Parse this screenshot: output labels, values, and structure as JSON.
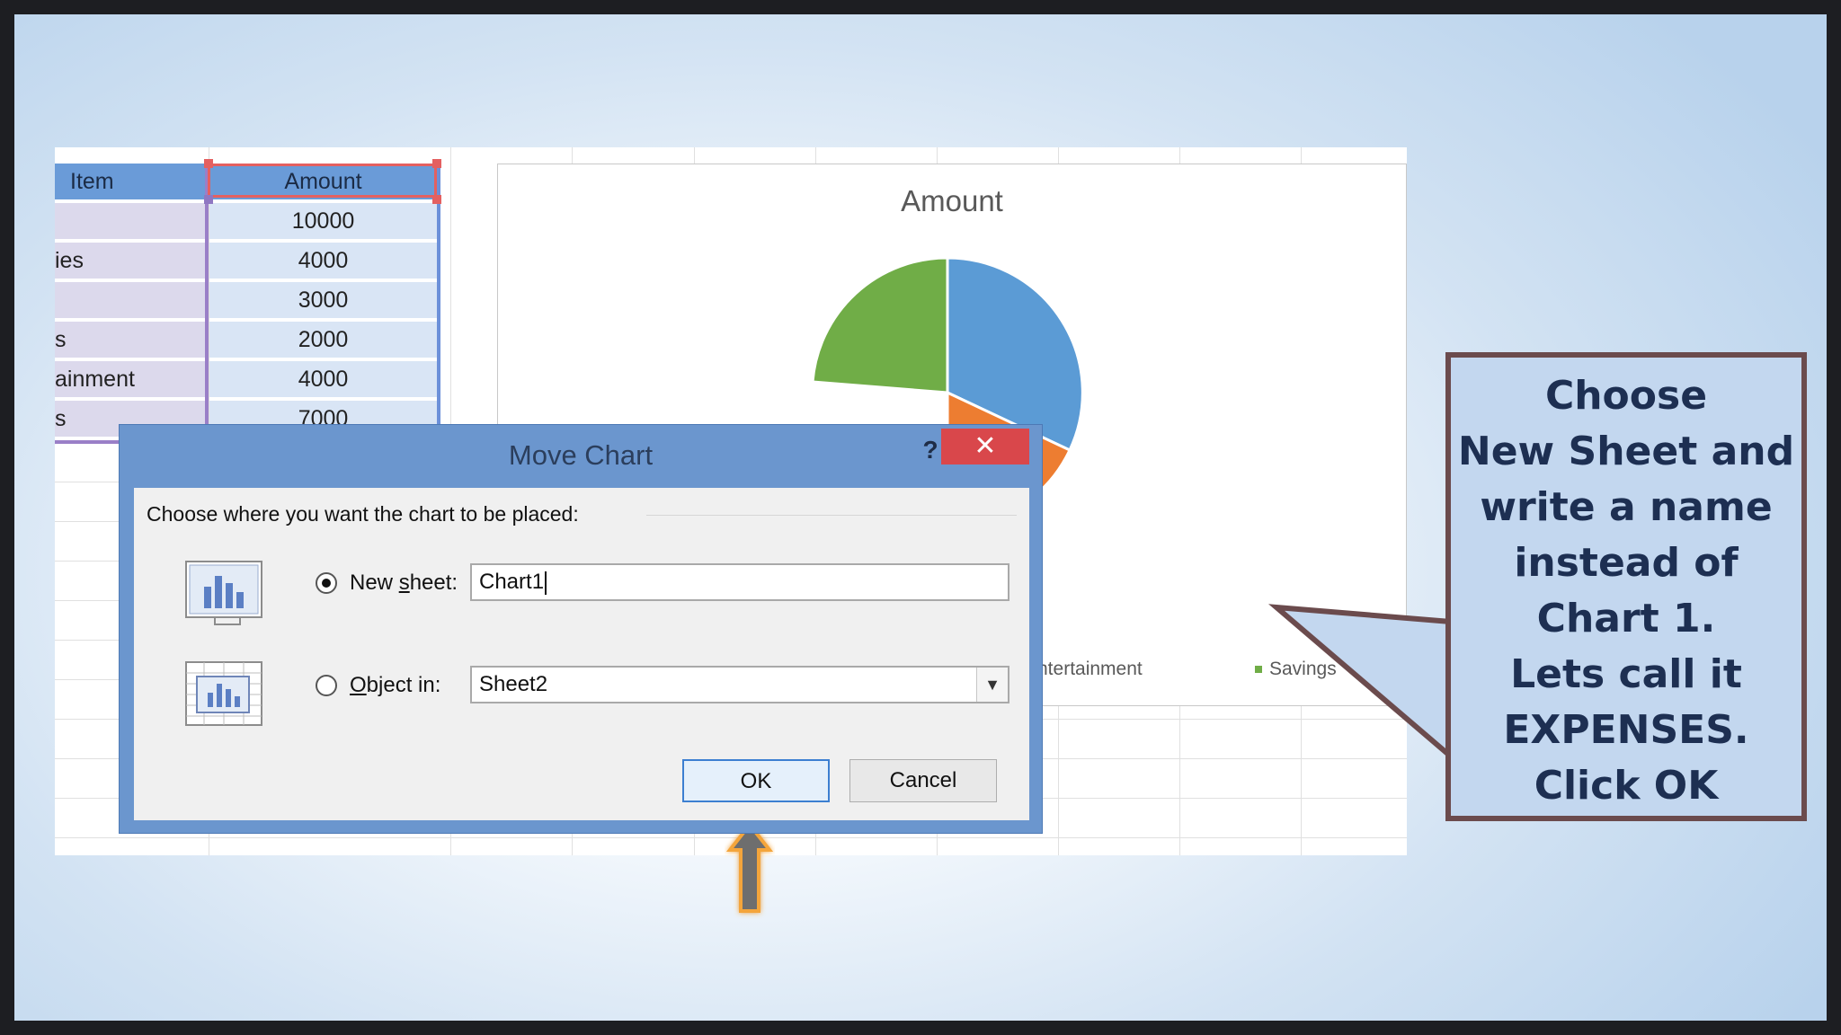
{
  "table": {
    "header": {
      "item": "Item",
      "amount": "Amount"
    },
    "rows": [
      {
        "item": "",
        "amount": "10000"
      },
      {
        "item": "ies",
        "amount": "4000"
      },
      {
        "item": "",
        "amount": "3000"
      },
      {
        "item": "s",
        "amount": "2000"
      },
      {
        "item": "ainment",
        "amount": "4000"
      },
      {
        "item": "s",
        "amount": "7000"
      }
    ]
  },
  "chart": {
    "title": "Amount",
    "legend": [
      {
        "label": "Entertainment",
        "color": "#ed7d31"
      },
      {
        "label": "Savings",
        "color": "#70ad47"
      }
    ],
    "colors": {
      "blue": "#5b9bd5",
      "orange": "#ed7d31",
      "green": "#70ad47"
    }
  },
  "dialog": {
    "title": "Move Chart",
    "help_label": "?",
    "close_label": "✕",
    "prompt": "Choose where you want the chart to be placed:",
    "new_sheet": {
      "label_pre": "New ",
      "label_u": "s",
      "label_post": "heet:",
      "value": "Chart1",
      "selected": true
    },
    "object_in": {
      "label_pre": "",
      "label_u": "O",
      "label_post": "bject in:",
      "value": "Sheet2",
      "selected": false
    },
    "ok_label": "OK",
    "cancel_label": "Cancel"
  },
  "callout": {
    "lines": [
      "Choose",
      "New Sheet and",
      "write a name",
      "instead of",
      "Chart 1.",
      "Lets call it",
      "EXPENSES.",
      "Click OK"
    ]
  }
}
